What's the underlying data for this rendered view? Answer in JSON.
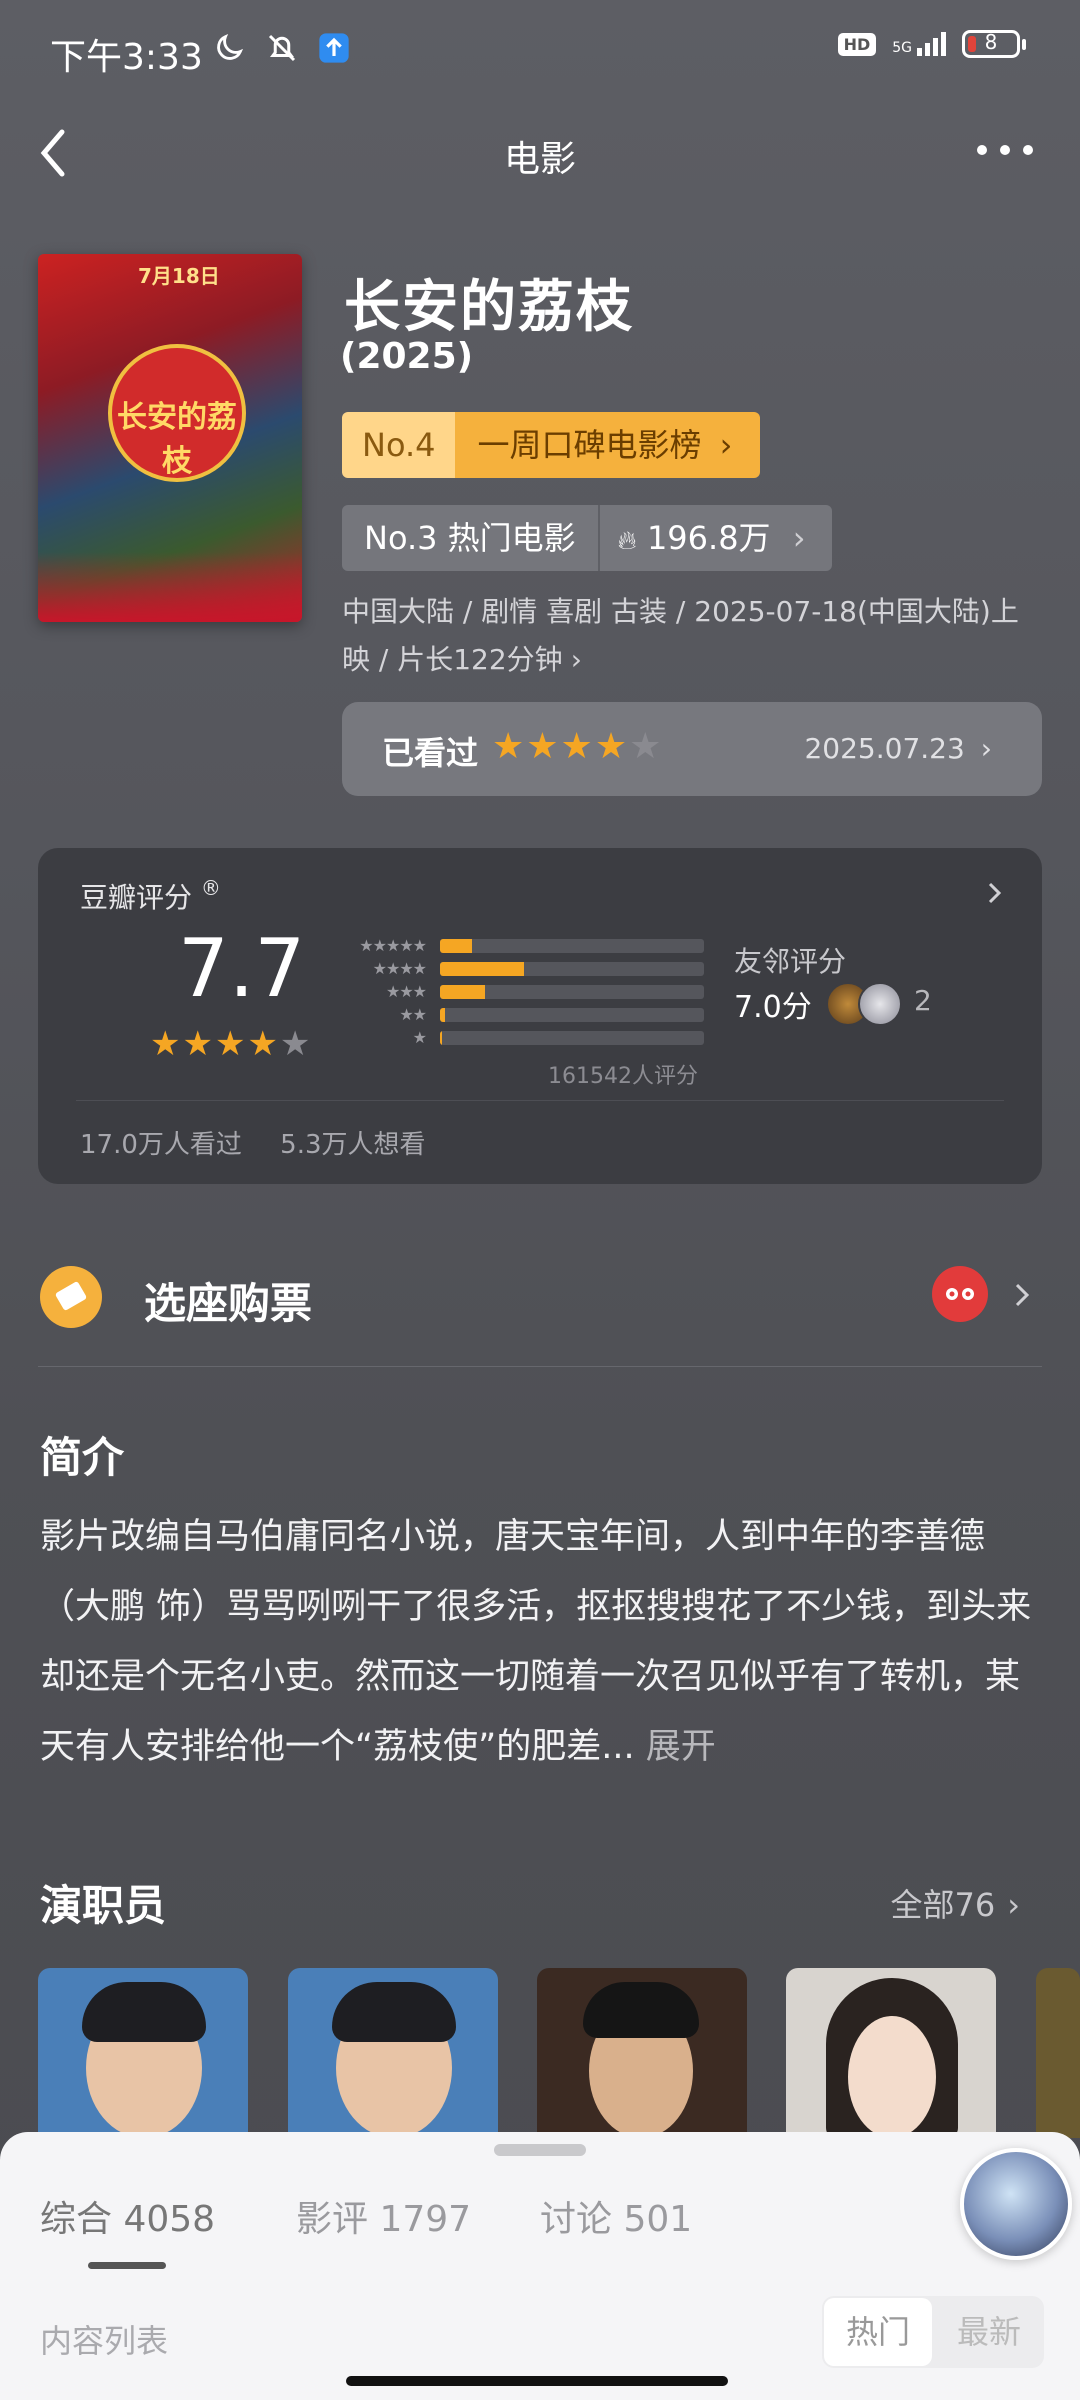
{
  "status_bar": {
    "time": "下午3:33",
    "hd": "HD",
    "network": "5G",
    "battery": "8"
  },
  "nav": {
    "title": "电影"
  },
  "movie": {
    "title": "长安的荔枝",
    "year": "(2025)",
    "poster_date": "7月18日",
    "poster_title": "长安的荔枝",
    "rank_weekly_no": "No.4",
    "rank_weekly_label": "一周口碑电影榜",
    "rank_hot_label": "No.3 热门电影",
    "rank_hot_count": "196.8万",
    "meta": "中国大陆 / 剧情 喜剧 古装 / 2025-07-18(中国大陆)上映 / 片长122分钟",
    "watched_label": "已看过",
    "watched_stars": 4,
    "watched_date": "2025.07.23"
  },
  "rating": {
    "label": "豆瓣评分",
    "reg_mark": "®",
    "score": "7.7",
    "stars": 4,
    "distribution": [
      {
        "stars": "★★★★★",
        "fraction": 0.12
      },
      {
        "stars": "★★★★",
        "fraction": 0.32
      },
      {
        "stars": "★★★",
        "fraction": 0.17
      },
      {
        "stars": "★★",
        "fraction": 0.02
      },
      {
        "stars": "★",
        "fraction": 0.005
      }
    ],
    "count_text": "161542人评分",
    "friend_label": "友邻评分",
    "friend_score": "7.0分",
    "friend_count": "2",
    "watched_count": "17.0万人看过",
    "want_count": "5.3万人想看"
  },
  "tickets": {
    "label": "选座购票"
  },
  "intro": {
    "title": "简介",
    "text": "影片改编自马伯庸同名小说，唐天宝年间，人到中年的李善德（大鹏 饰）骂骂咧咧干了很多活，抠抠搜搜花了不少钱，到头来却还是个无名小吏。然而这一切随着一次召见似乎有了转机，某天有人安排给他一个“荔枝使”的肥差...",
    "more": "展开"
  },
  "cast": {
    "title": "演职员",
    "all_label": "全部76"
  },
  "sheet": {
    "tabs": [
      "综合 4058",
      "影评 1797",
      "讨论 501"
    ],
    "list_label": "内容列表",
    "sort_hot": "热门",
    "sort_new": "最新"
  },
  "colors": {
    "accent_gold": "#f5a623",
    "rank_orange": "#f5b13d",
    "bg": "#55565c",
    "card": "#3c3d42"
  }
}
